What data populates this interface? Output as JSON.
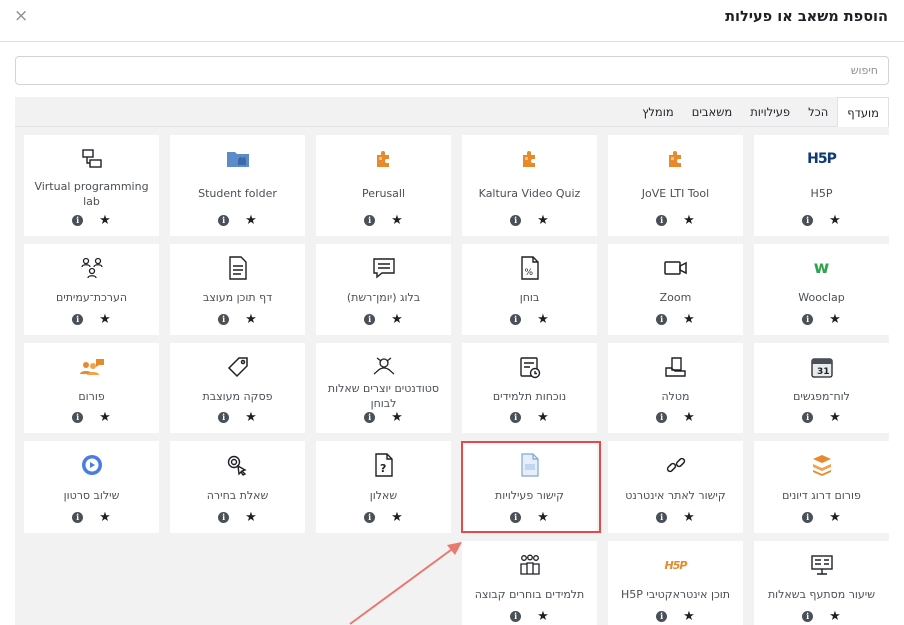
{
  "modal": {
    "title": "הוספת משאב או פעילות",
    "close_label": "×"
  },
  "search": {
    "placeholder": "חיפוש",
    "value": ""
  },
  "tabs": [
    "מועדף",
    "הכל",
    "פעילויות",
    "משאבים",
    "מומלץ"
  ],
  "active_tab": "מועדף",
  "colors": {
    "icon_orange": "#e8892b",
    "icon_blue": "#5b8bc9",
    "wooclap_green": "#2ea44f",
    "h5p_blue": "#0e3b73",
    "highlight": "#e8474c"
  },
  "cards": [
    [
      {
        "name": "H5P",
        "icon": "h5p-icon"
      },
      {
        "name": "JoVE LTI Tool",
        "icon": "puzzle-icon"
      },
      {
        "name": "Kaltura Video Quiz",
        "icon": "puzzle-icon"
      },
      {
        "name": "Perusall",
        "icon": "puzzle-icon"
      },
      {
        "name": "Student folder",
        "icon": "folder-icon"
      },
      {
        "name": "Virtual programming lab",
        "icon": "vpl-icon"
      }
    ],
    [
      {
        "name": "Wooclap",
        "icon": "wooclap-icon"
      },
      {
        "name": "Zoom",
        "icon": "video-camera-icon"
      },
      {
        "name": "בוחן",
        "icon": "quiz-icon"
      },
      {
        "name": "בלוג (יומן־רשת)",
        "icon": "blog-icon"
      },
      {
        "name": "דף תוכן מעוצב",
        "icon": "page-icon"
      },
      {
        "name": "הערכת־עמיתים",
        "icon": "peer-review-icon"
      }
    ],
    [
      {
        "name": "לוח־מפגשים",
        "icon": "calendar-icon"
      },
      {
        "name": "מטלה",
        "icon": "assignment-icon"
      },
      {
        "name": "נוכחות תלמידים",
        "icon": "attendance-icon"
      },
      {
        "name": "סטודנטים יוצרים שאלות לבוחן",
        "icon": "question-creation-icon"
      },
      {
        "name": "פסקה מעוצבת",
        "icon": "label-tag-icon"
      },
      {
        "name": "פורום",
        "icon": "forum-icon"
      }
    ],
    [
      {
        "name": "פורום דרוג דיונים",
        "icon": "stack-icon"
      },
      {
        "name": "קישור לאתר אינטרנט",
        "icon": "link-icon"
      },
      {
        "name": "קישור פעילויות",
        "icon": "activity-link-icon"
      },
      {
        "name": "שאלון",
        "icon": "questionnaire-icon"
      },
      {
        "name": "שאלת בחירה",
        "icon": "choice-icon"
      },
      {
        "name": "שילוב סרטון",
        "icon": "play-icon"
      }
    ],
    [
      {
        "name": "שיעור מסתעף בשאלות",
        "icon": "lesson-icon"
      },
      {
        "name": "תוכן אינטראקטיבי H5P",
        "icon": "h5p-interactive-icon"
      },
      {
        "name": "תלמידים בוחרים קבוצה",
        "icon": "group-choice-icon"
      }
    ]
  ],
  "icon_text": {
    "h5p": "H5P",
    "calendar_day": "31",
    "info_letter": "i",
    "star": "★"
  }
}
